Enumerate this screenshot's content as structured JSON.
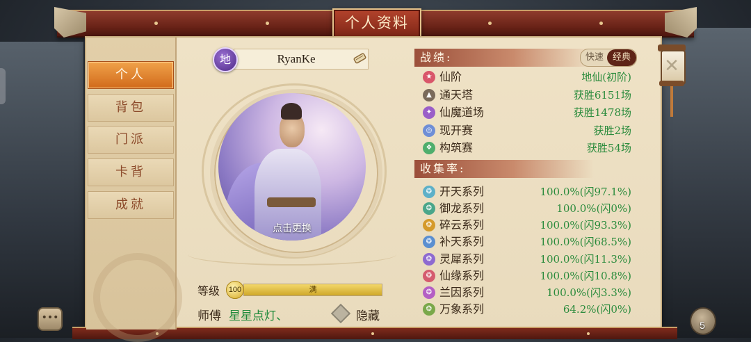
{
  "window": {
    "title": "个人资料"
  },
  "sidebar": {
    "items": [
      {
        "label": "个人",
        "active": true
      },
      {
        "label": "背包",
        "active": false
      },
      {
        "label": "门派",
        "active": false
      },
      {
        "label": "卡背",
        "active": false
      },
      {
        "label": "成就",
        "active": false
      }
    ]
  },
  "profile": {
    "rank_badge": "地",
    "name": "RyanKe",
    "avatar_caption": "点击更换",
    "level_label": "等级",
    "level_value": "100",
    "level_progress": 1.0,
    "level_bar_text": "满",
    "master_label": "师傅",
    "master_name": "星星点灯、",
    "hide_label": "隐藏"
  },
  "record": {
    "heading": "战绩:",
    "mode_toggle": {
      "option_a": "快速",
      "option_b": "经典",
      "selected": "经典"
    },
    "rows": [
      {
        "icon": "star-icon",
        "color": "#d9566a",
        "label": "仙阶",
        "value": "地仙(初阶)"
      },
      {
        "icon": "tower-icon",
        "color": "#7a6a5a",
        "label": "通天塔",
        "value": "获胜6151场"
      },
      {
        "icon": "demon-icon",
        "color": "#9a5ec8",
        "label": "仙魔道场",
        "value": "获胜1478场"
      },
      {
        "icon": "open-icon",
        "color": "#6e8ed6",
        "label": "现开赛",
        "value": "获胜2场"
      },
      {
        "icon": "build-icon",
        "color": "#4fae6c",
        "label": "构筑赛",
        "value": "获胜54场"
      }
    ]
  },
  "collection": {
    "heading": "收集率:",
    "rows": [
      {
        "icon": "kaitian-icon",
        "color": "#5db0c8",
        "label": "开天系列",
        "value": "100.0%(闪97.1%)"
      },
      {
        "icon": "yulong-icon",
        "color": "#4aa68a",
        "label": "御龙系列",
        "value": "100.0%(闪0%)"
      },
      {
        "icon": "suiyun-icon",
        "color": "#d59a2a",
        "label": "碎云系列",
        "value": "100.0%(闪93.3%)"
      },
      {
        "icon": "butian-icon",
        "color": "#5b8fd0",
        "label": "补天系列",
        "value": "100.0%(闪68.5%)"
      },
      {
        "icon": "lingxi-icon",
        "color": "#8e6ad0",
        "label": "灵犀系列",
        "value": "100.0%(闪11.3%)"
      },
      {
        "icon": "xianyuan-icon",
        "color": "#d55b6e",
        "label": "仙缘系列",
        "value": "100.0%(闪10.8%)"
      },
      {
        "icon": "lanyin-icon",
        "color": "#b45fc4",
        "label": "兰因系列",
        "value": "100.0%(闪3.3%)"
      },
      {
        "icon": "wanxiang-icon",
        "color": "#7aa84a",
        "label": "万象系列",
        "value": "64.2%(闪0%)"
      }
    ]
  },
  "footer": {
    "bag_count": "5"
  }
}
